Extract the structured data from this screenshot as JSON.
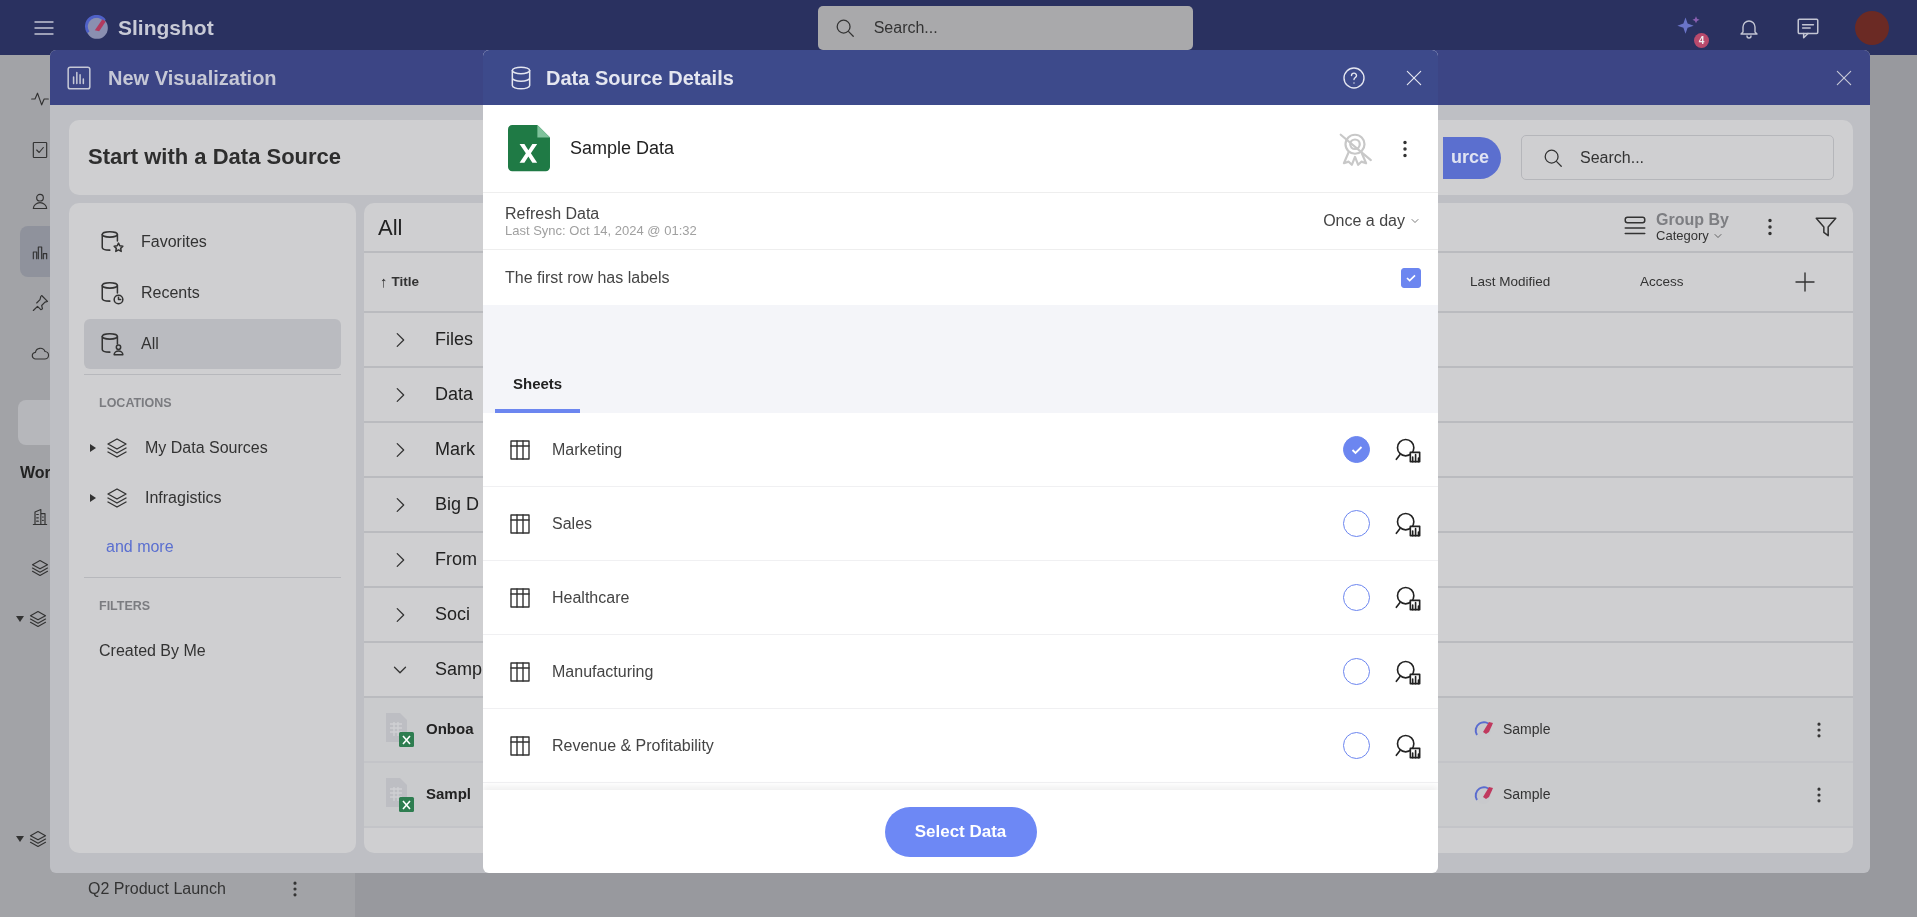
{
  "app_bar": {
    "brand": "Slingshot",
    "search": {
      "placeholder": "Search..."
    },
    "badge": "4"
  },
  "app_nav": {
    "items": [
      {
        "kind": "activity",
        "selected": false
      },
      {
        "kind": "tasks",
        "selected": false
      },
      {
        "kind": "people",
        "selected": false
      },
      {
        "kind": "analytics",
        "selected": true
      },
      {
        "kind": "pin",
        "selected": false
      },
      {
        "kind": "cloud",
        "selected": false
      }
    ],
    "section_label": "Wor",
    "workspaces": [
      {
        "kind": "building"
      },
      {
        "kind": "layers"
      },
      {
        "kind": "group",
        "expanded": true
      }
    ],
    "bottom_group": {
      "expanded": true,
      "children": [
        {
          "label": "Q2 Product Launch"
        }
      ]
    }
  },
  "new_visualization": {
    "title": "New Visualization",
    "heading": "Start with a Data Source",
    "button": "urce",
    "search": {
      "placeholder": "Search..."
    },
    "nav": {
      "items": [
        {
          "label": "Favorites",
          "kind": "star",
          "selected": false
        },
        {
          "label": "Recents",
          "kind": "clock",
          "selected": false
        },
        {
          "label": "All",
          "kind": "user",
          "selected": true
        }
      ],
      "locations_heading": "LOCATIONS",
      "locations": [
        {
          "label": "My Data Sources",
          "expanded": false
        },
        {
          "label": "Infragistics",
          "expanded": false
        }
      ],
      "more_link": "and more",
      "filters_heading": "FILTERS",
      "filters": [
        "Created By Me"
      ]
    },
    "list": {
      "title": "All",
      "group_by": {
        "label": "Group By",
        "value": "Category"
      },
      "columns": [
        {
          "label": "Title",
          "sort_indicator": "↑"
        },
        {
          "label": "Last Modified"
        },
        {
          "label": "Access"
        }
      ],
      "groups": [
        {
          "label": "Files",
          "expanded": false
        },
        {
          "label": "Data",
          "expanded": false
        },
        {
          "label": "Mark",
          "expanded": false
        },
        {
          "label": "Big D",
          "expanded": false
        },
        {
          "label": "From",
          "expanded": false
        },
        {
          "label": "Soci",
          "expanded": false
        },
        {
          "label": "Samp",
          "expanded": true
        }
      ],
      "rows": [
        {
          "title": "Onboa",
          "source": "Sample"
        },
        {
          "title": "Sampl",
          "source": "Sample"
        }
      ]
    }
  },
  "details": {
    "title": "Data Source Details",
    "name": "Sample Data",
    "refresh": {
      "label": "Refresh Data",
      "last_sync": "Last Sync: Oct 14, 2024 @ 01:32",
      "frequency": "Once a day"
    },
    "first_row_labels": {
      "label": "The first row has labels",
      "checked": true
    },
    "tabs": [
      {
        "label": "Sheets",
        "selected": true
      }
    ],
    "sheets": [
      {
        "name": "Marketing",
        "selected": true
      },
      {
        "name": "Sales",
        "selected": false
      },
      {
        "name": "Healthcare",
        "selected": false
      },
      {
        "name": "Manufacturing",
        "selected": false
      },
      {
        "name": "Revenue & Profitability",
        "selected": false
      }
    ],
    "primary_button": "Select Data"
  }
}
